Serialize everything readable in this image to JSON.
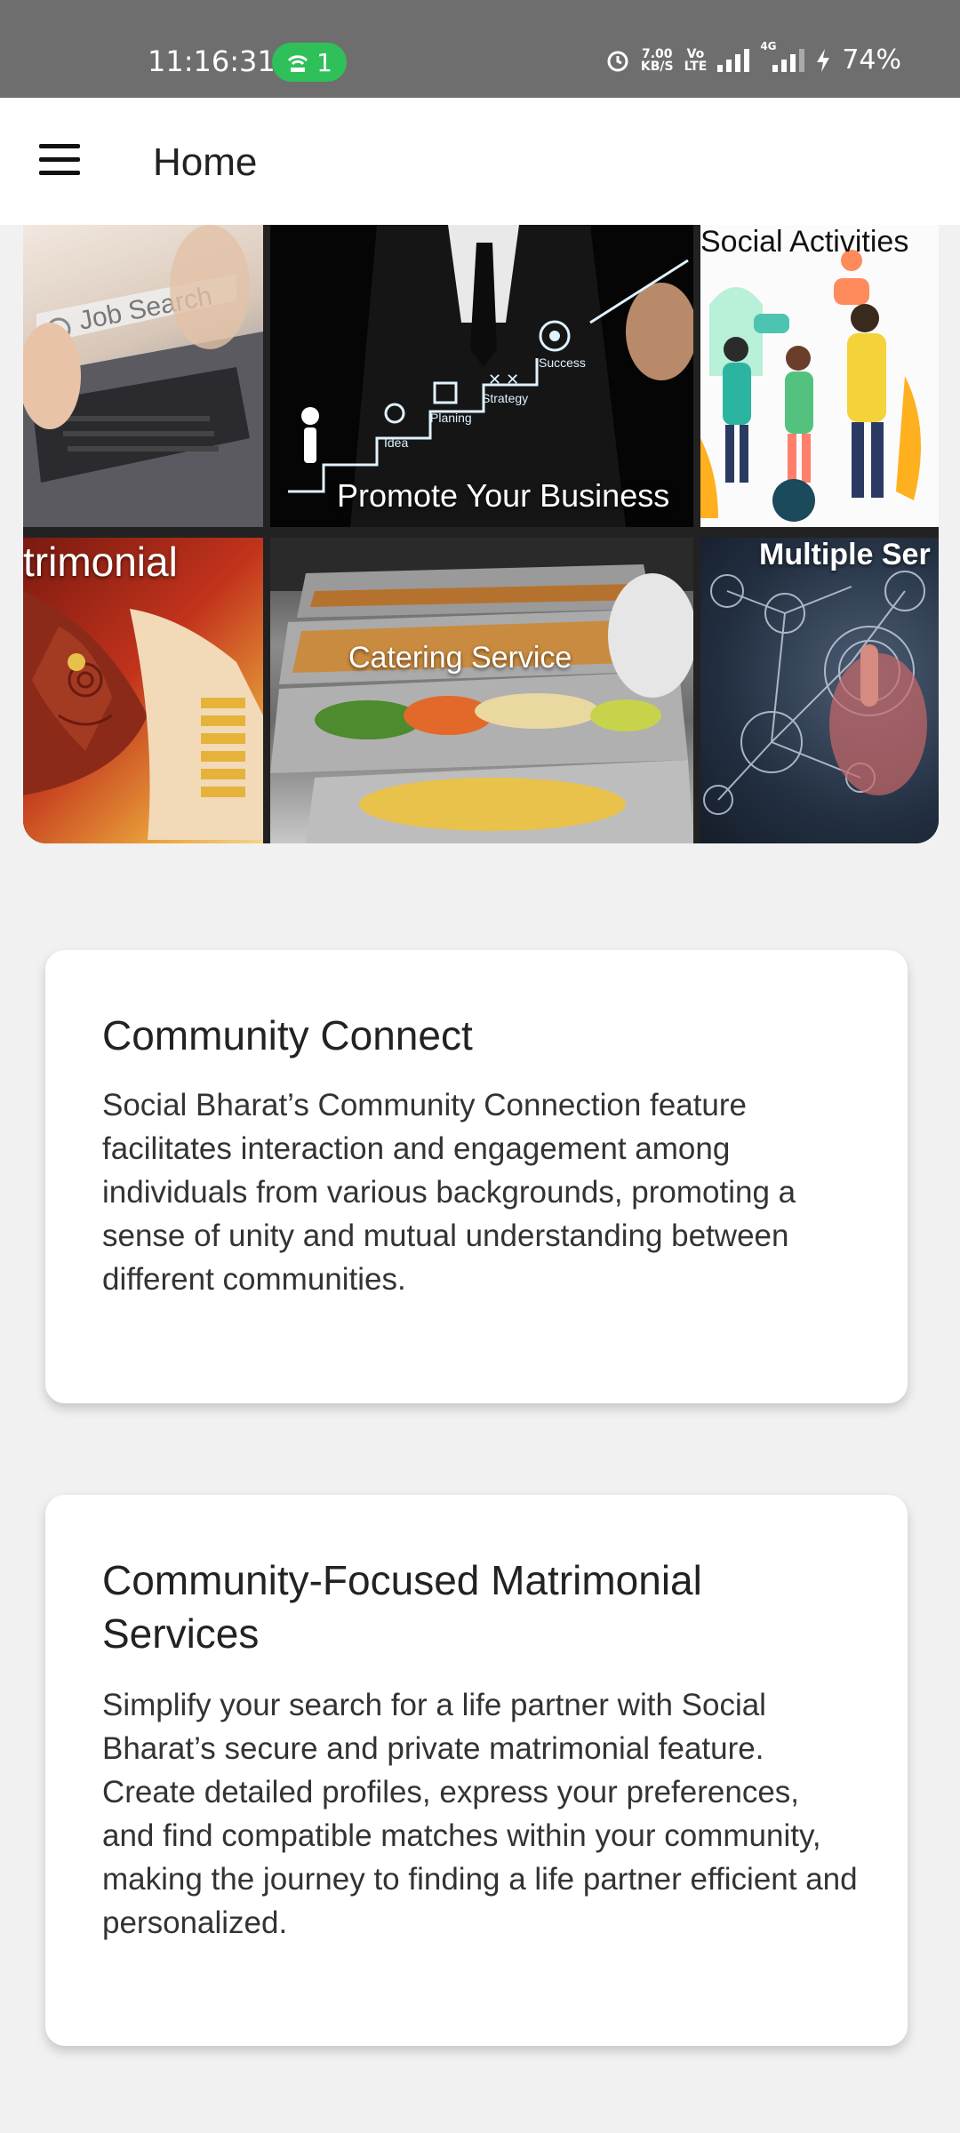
{
  "status_bar": {
    "time": "11:16:31",
    "hotspot_count": "1",
    "net_speed_value": "7.00",
    "net_speed_unit": "KB/S",
    "volte_top": "Vo",
    "volte_bottom": "LTE",
    "network_type": "4G",
    "battery": "74%"
  },
  "app_bar": {
    "title": "Home",
    "menu_icon": "hamburger-menu-icon"
  },
  "collage": {
    "tiles": [
      {
        "label": "Job Search",
        "icon": "laptop-search-image"
      },
      {
        "label": "Promote Your Business",
        "icon": "business-staircase-image"
      },
      {
        "label": "Social Activities",
        "icon": "people-chatting-image"
      },
      {
        "label": "trimonial",
        "icon": "wedding-hands-image"
      },
      {
        "label": "Catering Service",
        "icon": "buffet-food-image"
      },
      {
        "label": "Multiple Ser",
        "icon": "network-touch-image"
      }
    ],
    "business_steps": [
      "Idea",
      "Planing",
      "Strategy",
      "Success"
    ]
  },
  "cards": [
    {
      "title": "Community Connect",
      "body": "Social Bharat’s Community Connection feature facilitates interaction and engagement among individuals from various backgrounds, promoting a sense of unity and mutual understanding between different communities."
    },
    {
      "title": "Community-Focused Matrimonial Services",
      "body": "Simplify your search for a life partner with Social Bharat’s secure and private matrimonial feature. Create detailed profiles, express your preferences, and find compatible matches within your community, making the journey to finding a life partner efficient and personalized."
    }
  ]
}
